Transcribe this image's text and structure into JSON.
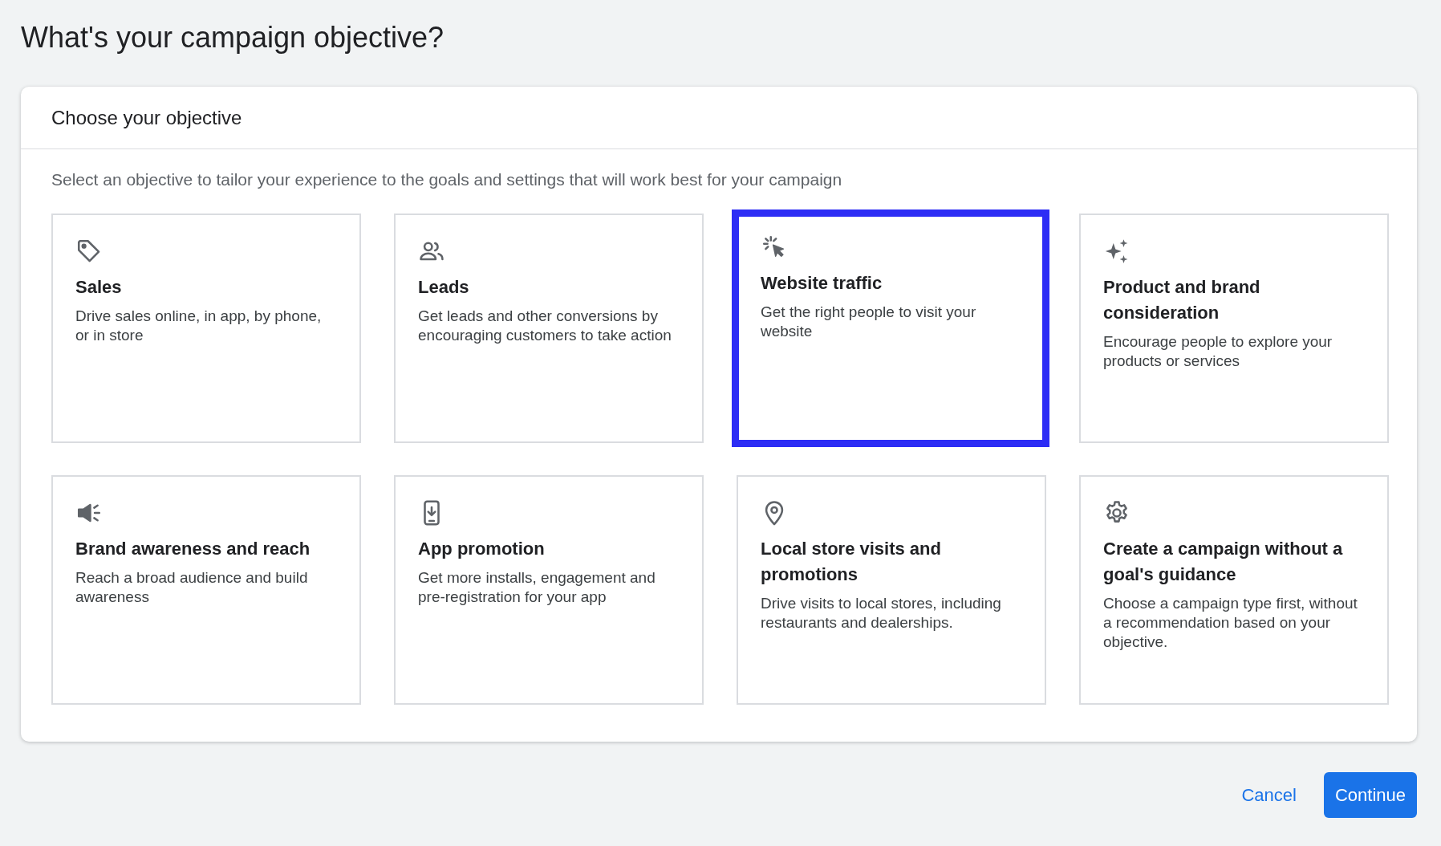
{
  "page_title": "What's your campaign objective?",
  "card": {
    "title": "Choose your objective",
    "description": "Select an objective to tailor your experience to the goals and settings that will work best for your campaign",
    "objectives": [
      {
        "kind": "tag",
        "title": "Sales",
        "description": "Drive sales online, in app, by phone, or in store",
        "selected": false
      },
      {
        "kind": "people",
        "title": "Leads",
        "description": "Get leads and other conversions by encouraging customers to take action",
        "selected": false
      },
      {
        "kind": "click",
        "title": "Website traffic",
        "description": "Get the right people to visit your website",
        "selected": true
      },
      {
        "kind": "sparkle",
        "title": "Product and brand consideration",
        "description": "Encourage people to explore your products or services",
        "selected": false
      },
      {
        "kind": "megaphone",
        "title": "Brand awareness and reach",
        "description": "Reach a broad audience and build awareness",
        "selected": false
      },
      {
        "kind": "phone",
        "title": "App promotion",
        "description": "Get more installs, engagement and pre-registration for your app",
        "selected": false
      },
      {
        "kind": "pin",
        "title": "Local store visits and promotions",
        "description": "Drive visits to local stores, including restaurants and dealerships.",
        "selected": false
      },
      {
        "kind": "gear",
        "title": "Create a campaign without a goal's guidance",
        "description": "Choose a campaign type first, without a recommendation based on your objective.",
        "selected": false
      }
    ]
  },
  "buttons": {
    "cancel": "Cancel",
    "continue": "Continue"
  }
}
